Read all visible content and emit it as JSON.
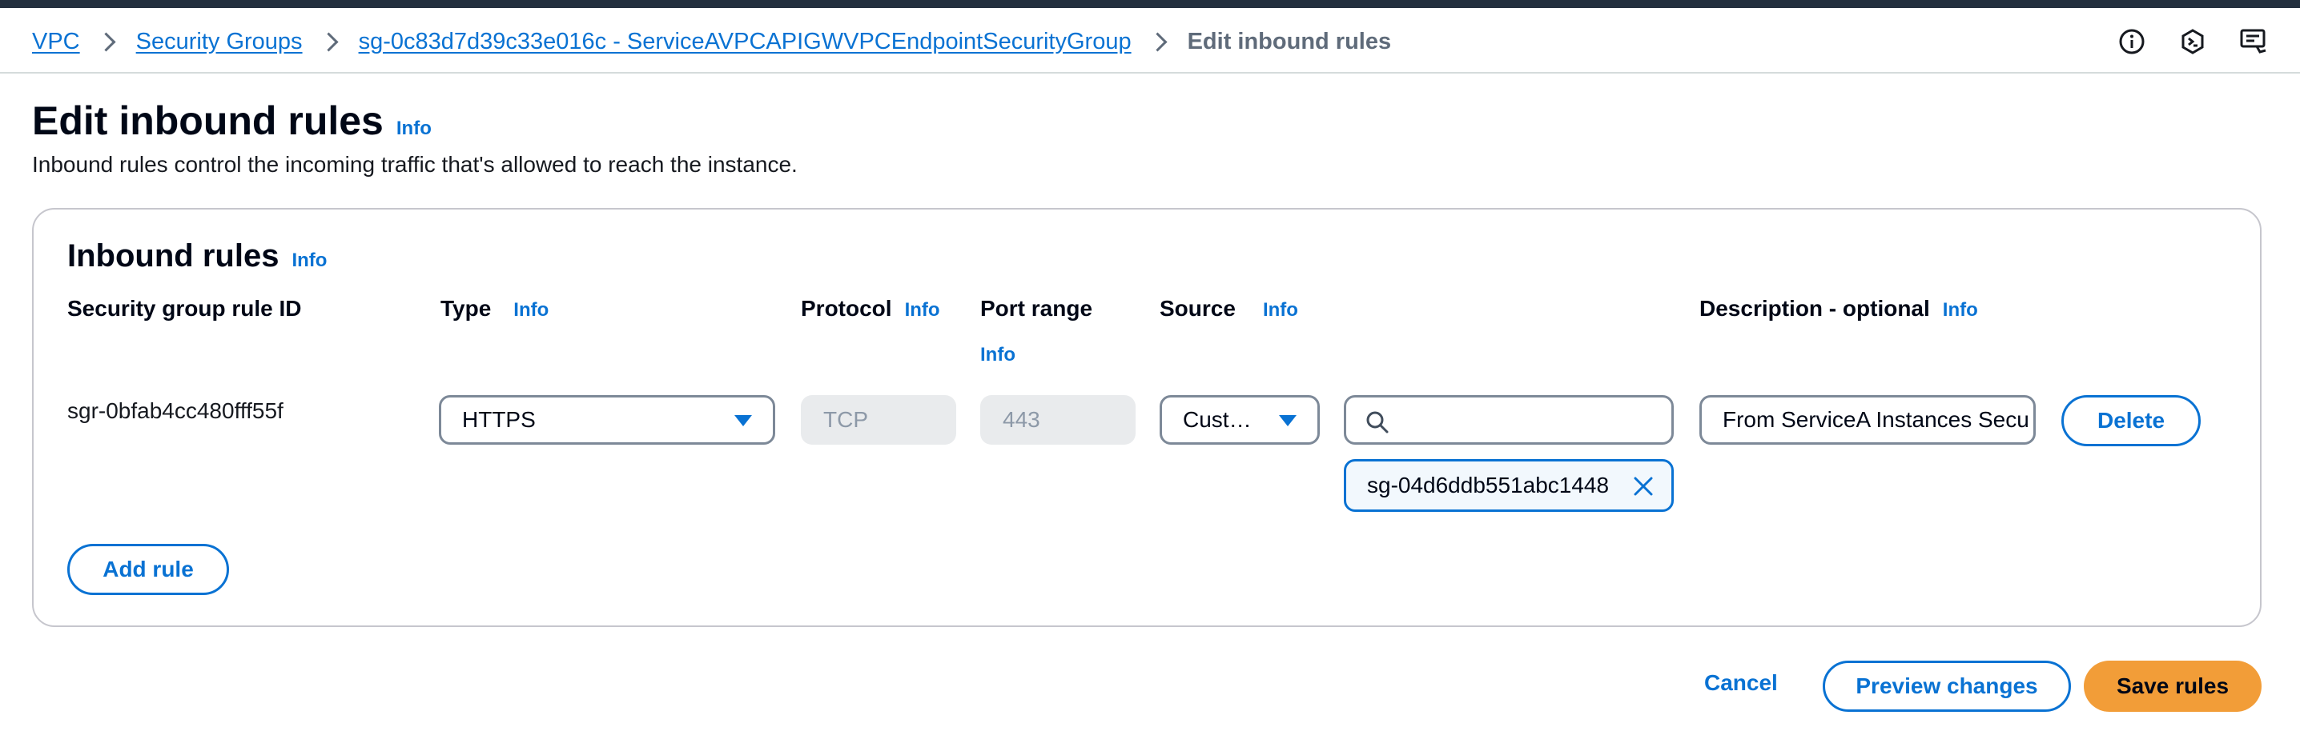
{
  "breadcrumb": {
    "items": [
      {
        "label": "VPC"
      },
      {
        "label": "Security Groups"
      },
      {
        "label": "sg-0c83d7d39c33e016c - ServiceAVPCAPIGWVPCEndpointSecurityGroup"
      }
    ],
    "current": "Edit inbound rules"
  },
  "toolbar_icons": [
    "info-circle-icon",
    "cloudshell-hexagon-icon",
    "feedback-icon"
  ],
  "page": {
    "title": "Edit inbound rules",
    "title_info": "Info",
    "description": "Inbound rules control the incoming traffic that's allowed to reach the instance."
  },
  "panel": {
    "title": "Inbound rules",
    "title_info": "Info",
    "columns": {
      "rule_id": "Security group rule ID",
      "type": "Type",
      "type_info": "Info",
      "protocol": "Protocol",
      "protocol_info": "Info",
      "port_range": "Port range",
      "port_range_info": "Info",
      "source": "Source",
      "source_info": "Info",
      "description": "Description - optional",
      "description_info": "Info"
    },
    "rule": {
      "id": "sgr-0bfab4cc480fff55f",
      "type": "HTTPS",
      "protocol": "TCP",
      "port_range": "443",
      "source_type": "Cust…",
      "source_search_value": "",
      "source_token": "sg-04d6ddb551abc1448",
      "description": "From ServiceA Instances Secu",
      "delete_label": "Delete"
    },
    "add_rule_label": "Add rule"
  },
  "footer": {
    "cancel_label": "Cancel",
    "preview_label": "Preview changes",
    "save_label": "Save rules"
  },
  "colors": {
    "link": "#0972d3",
    "primary_button": "#f29d38",
    "top_bar": "#232f3e"
  }
}
